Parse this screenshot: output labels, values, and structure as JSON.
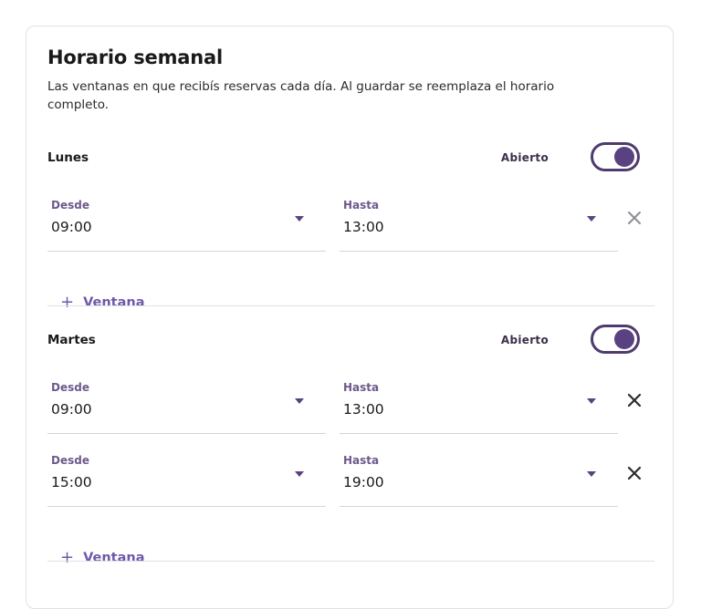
{
  "header": {
    "title": "Horario semanal",
    "subtitle": "Las ventanas en que recibís reservas cada día. Al guardar se reemplaza el horario completo."
  },
  "days": [
    {
      "name": "Lunes",
      "status_label": "Abierto",
      "open": true,
      "add_label": "Ventana",
      "windows": [
        {
          "from_label": "Desde",
          "from": "09:00",
          "to_label": "Hasta",
          "to": "13:00",
          "remove_enabled": false
        }
      ]
    },
    {
      "name": "Martes",
      "status_label": "Abierto",
      "open": true,
      "add_label": "Ventana",
      "windows": [
        {
          "from_label": "Desde",
          "from": "09:00",
          "to_label": "Hasta",
          "to": "13:00",
          "remove_enabled": true
        },
        {
          "from_label": "Desde",
          "from": "15:00",
          "to_label": "Hasta",
          "to": "19:00",
          "remove_enabled": true
        }
      ]
    }
  ],
  "colors": {
    "accent": "#5a4282",
    "accent_link": "#6d5aa8",
    "remove_disabled": "#8e8e93",
    "remove_enabled": "#2b2b2b"
  },
  "icons": {
    "remove": "close-icon",
    "add": "plus-icon",
    "dropdown": "caret-down-icon"
  }
}
